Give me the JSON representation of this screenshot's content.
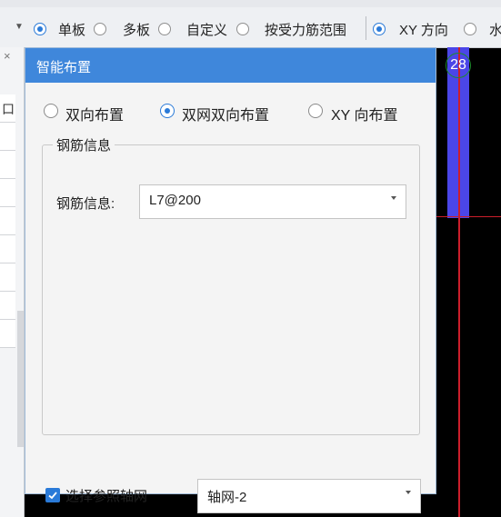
{
  "toolbar": {
    "options": [
      {
        "label": "单板",
        "selected": true
      },
      {
        "label": "多板",
        "selected": false
      },
      {
        "label": "自定义",
        "selected": false
      },
      {
        "label": "按受力筋范围",
        "selected": false
      }
    ],
    "dir_options": [
      {
        "label": "XY 方向",
        "selected": true
      },
      {
        "label": "水",
        "selected": false
      }
    ]
  },
  "left_panel": {
    "close_glyph": "×",
    "row_glyph": "口"
  },
  "canvas": {
    "marker_label": "28",
    "colors": {
      "axis_line": "#cc1e2b",
      "bar": "#4b46e8",
      "marker_ring": "#1d8b2f"
    }
  },
  "dialog": {
    "title": "智能布置",
    "layout_options": [
      {
        "label": "双向布置",
        "selected": false
      },
      {
        "label": "双网双向布置",
        "selected": true
      },
      {
        "label": "XY 向布置",
        "selected": false
      }
    ],
    "group_title": "钢筋信息",
    "rebar_label": "钢筋信息:",
    "rebar_value": "L7@200",
    "ref_grid_checkbox_label": "选择参照轴网",
    "ref_grid_checked": true,
    "ref_grid_value": "轴网-2"
  }
}
